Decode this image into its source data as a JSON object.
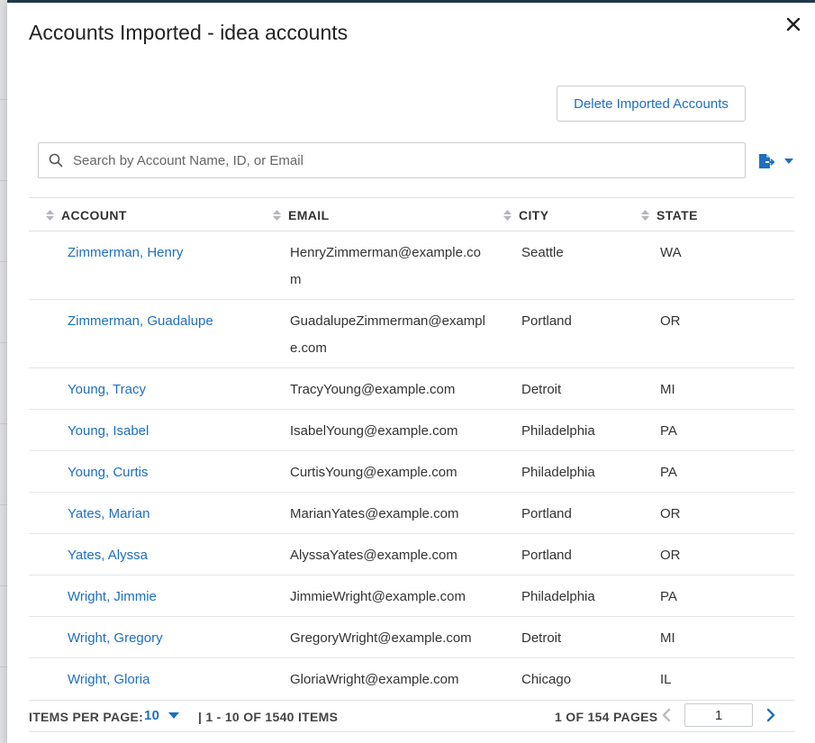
{
  "modal": {
    "title": "Accounts Imported - idea accounts",
    "close_icon": "close-icon",
    "delete_button_label": "Delete Imported Accounts",
    "accent_color": "#1e6fc0"
  },
  "search": {
    "placeholder": "Search by Account Name, ID, or Email",
    "value": ""
  },
  "export": {
    "icon": "export-file-icon",
    "dropdown_icon": "caret-down-icon"
  },
  "table": {
    "columns": [
      "ACCOUNT",
      "EMAIL",
      "CITY",
      "STATE"
    ],
    "rows": [
      {
        "account": "Zimmerman, Henry",
        "email": "HenryZimmerman@example.com",
        "city": "Seattle",
        "state": "WA"
      },
      {
        "account": "Zimmerman, Guadalupe",
        "email": "GuadalupeZimmerman@example.com",
        "city": "Portland",
        "state": "OR"
      },
      {
        "account": "Young, Tracy",
        "email": "TracyYoung@example.com",
        "city": "Detroit",
        "state": "MI"
      },
      {
        "account": "Young, Isabel",
        "email": "IsabelYoung@example.com",
        "city": "Philadelphia",
        "state": "PA"
      },
      {
        "account": "Young, Curtis",
        "email": "CurtisYoung@example.com",
        "city": "Philadelphia",
        "state": "PA"
      },
      {
        "account": "Yates, Marian",
        "email": "MarianYates@example.com",
        "city": "Portland",
        "state": "OR"
      },
      {
        "account": "Yates, Alyssa",
        "email": "AlyssaYates@example.com",
        "city": "Portland",
        "state": "OR"
      },
      {
        "account": "Wright, Jimmie",
        "email": "JimmieWright@example.com",
        "city": "Philadelphia",
        "state": "PA"
      },
      {
        "account": "Wright, Gregory",
        "email": "GregoryWright@example.com",
        "city": "Detroit",
        "state": "MI"
      },
      {
        "account": "Wright, Gloria",
        "email": "GloriaWright@example.com",
        "city": "Chicago",
        "state": "IL"
      }
    ]
  },
  "pagination": {
    "items_per_page_label": "ITEMS PER PAGE:",
    "items_per_page_value": "10",
    "range_text": "| 1 - 10 OF 1540 ITEMS",
    "pages_text": "1 OF 154 PAGES",
    "current_page": "1"
  }
}
